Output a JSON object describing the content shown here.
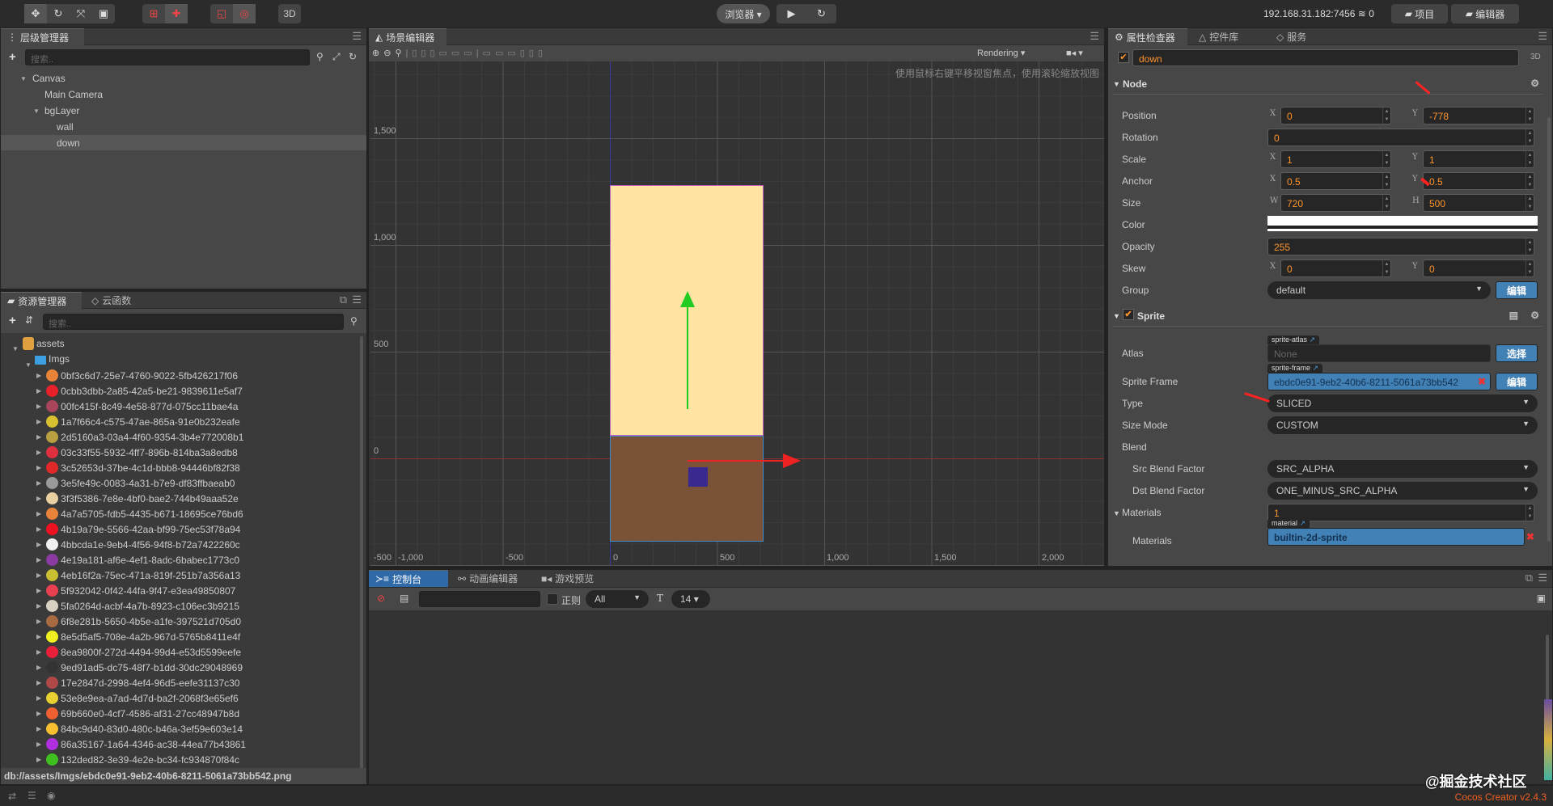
{
  "toolbar": {
    "preview_select": "浏览器 ▾",
    "mode_3d": "3D",
    "ip": "192.168.31.182:7456",
    "wifi_count": "0",
    "project_btn": "项目",
    "editor_btn": "编辑器"
  },
  "hierarchy": {
    "tab": "层级管理器",
    "search_placeholder": "搜索..",
    "nodes": [
      {
        "label": "Canvas"
      },
      {
        "label": "Main Camera"
      },
      {
        "label": "bgLayer"
      },
      {
        "label": "wall"
      },
      {
        "label": "down",
        "selected": true
      }
    ]
  },
  "assets_panel": {
    "tab": "资源管理器",
    "tab2": "云函数",
    "search_placeholder": "搜索..",
    "root": "assets",
    "folder": "Imgs",
    "items": [
      {
        "name": "0bf3c6d7-25e7-4760-9022-5fb426217f06",
        "color": "#e8833a"
      },
      {
        "name": "0cbb3dbb-2a85-42a5-be21-9839611e5af7",
        "color": "#e8202a"
      },
      {
        "name": "00fc415f-8c49-4e58-877d-075cc11bae4a",
        "color": "#a8455a"
      },
      {
        "name": "1a7f66c4-c575-47ae-865a-91e0b232eafe",
        "color": "#d8c030"
      },
      {
        "name": "2d5160a3-03a4-4f60-9354-3b4e772008b1",
        "color": "#b8a040"
      },
      {
        "name": "03c33f55-5932-4ff7-896b-814ba3a8edb8",
        "color": "#e03040"
      },
      {
        "name": "3c52653d-37be-4c1d-bbb8-94446bf82f38",
        "color": "#e02828"
      },
      {
        "name": "3e5fe49c-0083-4a31-b7e9-df83ffbaeab0",
        "color": "#999999"
      },
      {
        "name": "3f3f5386-7e8e-4bf0-bae2-744b49aaa52e",
        "color": "#e8d0a0"
      },
      {
        "name": "4a7a5705-fdb5-4435-b671-18695ce76bd6",
        "color": "#e8833a"
      },
      {
        "name": "4b19a79e-5566-42aa-bf99-75ec53f78a94",
        "color": "#ee1122"
      },
      {
        "name": "4bbcda1e-9eb4-4f56-94f8-b72a7422260c",
        "color": "#f0f0f0"
      },
      {
        "name": "4e19a181-af6e-4ef1-8adc-6babec1773c0",
        "color": "#8a3aa0"
      },
      {
        "name": "4eb16f2a-75ec-471a-819f-251b7a356a13",
        "color": "#c8c030"
      },
      {
        "name": "5f932042-0f42-44fa-9f47-e3ea49850807",
        "color": "#e84050"
      },
      {
        "name": "5fa0264d-acbf-4a7b-8923-c106ec3b9215",
        "color": "#d8d0c0"
      },
      {
        "name": "6f8e281b-5650-4b5e-a1fe-397521d705d0",
        "color": "#a86a40"
      },
      {
        "name": "8e5d5af5-708e-4a2b-967d-5765b8411e4f",
        "color": "#f0f020"
      },
      {
        "name": "8ea9800f-272d-4494-99d4-e53d5599eefe",
        "color": "#e8203a"
      },
      {
        "name": "9ed91ad5-dc75-48f7-b1dd-30dc29048969",
        "color": "#333333"
      },
      {
        "name": "17e2847d-2998-4ef4-96d5-eefe31137c30",
        "color": "#b04848"
      },
      {
        "name": "53e8e9ea-a7ad-4d7d-ba2f-2068f3e65ef6",
        "color": "#e8d030"
      },
      {
        "name": "69b660e0-4cf7-4586-af31-27cc48947b8d",
        "color": "#f06030"
      },
      {
        "name": "84bc9d40-83d0-480c-b46a-3ef59e603e14",
        "color": "#f8c030"
      },
      {
        "name": "86a35167-1a64-4346-ac38-44ea77b43861",
        "color": "#b030e0"
      },
      {
        "name": "132ded82-3e39-4e2e-bc34-fc934870f84c",
        "color": "#40c020"
      }
    ],
    "status_path": "db://assets/Imgs/ebdc0e91-9eb2-40b6-8211-5061a73bb542.png"
  },
  "scene": {
    "tab": "场景编辑器",
    "rendering": "Rendering",
    "hint": "使用鼠标右键平移视窗焦点，使用滚轮缩放视图",
    "y_ticks": [
      "1,500",
      "1,000",
      "500",
      "0",
      "-500"
    ],
    "x_ticks": [
      "-1,000",
      "-500",
      "0",
      "500",
      "1,000",
      "1,500",
      "2,000"
    ],
    "colors": {
      "top_sprite": "#ffe4a3",
      "bottom_sprite": "#7a5238"
    }
  },
  "inspector": {
    "tabs": [
      "属性检查器",
      "控件库",
      "服务"
    ],
    "node_name": "down",
    "mode_3d": "3D",
    "node_section": "Node",
    "position": {
      "label": "Position",
      "x": "0",
      "y": "-778"
    },
    "rotation": {
      "label": "Rotation",
      "value": "0"
    },
    "scale": {
      "label": "Scale",
      "x": "1",
      "y": "1"
    },
    "anchor": {
      "label": "Anchor",
      "x": "0.5",
      "y": "0.5"
    },
    "size": {
      "label": "Size",
      "w": "720",
      "h": "500"
    },
    "color": {
      "label": "Color",
      "value": "#ffffff"
    },
    "opacity": {
      "label": "Opacity",
      "value": "255"
    },
    "skew": {
      "label": "Skew",
      "x": "0",
      "y": "0"
    },
    "group": {
      "label": "Group",
      "value": "default",
      "edit": "编辑"
    },
    "sprite_section": "Sprite",
    "atlas": {
      "label": "Atlas",
      "tag": "sprite-atlas",
      "value": "None",
      "btn": "选择"
    },
    "sprite_frame": {
      "label": "Sprite Frame",
      "tag": "sprite-frame",
      "value": "ebdc0e91-9eb2-40b6-8211-5061a73bb542",
      "btn": "编辑"
    },
    "type": {
      "label": "Type",
      "value": "SLICED"
    },
    "size_mode": {
      "label": "Size Mode",
      "value": "CUSTOM"
    },
    "blend": {
      "label": "Blend"
    },
    "src_blend": {
      "label": "Src Blend Factor",
      "value": "SRC_ALPHA"
    },
    "dst_blend": {
      "label": "Dst Blend Factor",
      "value": "ONE_MINUS_SRC_ALPHA"
    },
    "materials_count": {
      "label": "Materials",
      "value": "1"
    },
    "materials": {
      "label": "Materials",
      "tag": "material",
      "value": "builtin-2d-sprite"
    },
    "axis": {
      "x": "X",
      "y": "Y",
      "w": "W",
      "h": "H"
    }
  },
  "console": {
    "tabs": [
      "控制台",
      "动画编辑器",
      "游戏预览"
    ],
    "regex": "正则",
    "level": "All",
    "font_size": "14"
  },
  "footer": {
    "watermark": "@掘金技术社区",
    "version": "Cocos Creator v2.4.3"
  }
}
